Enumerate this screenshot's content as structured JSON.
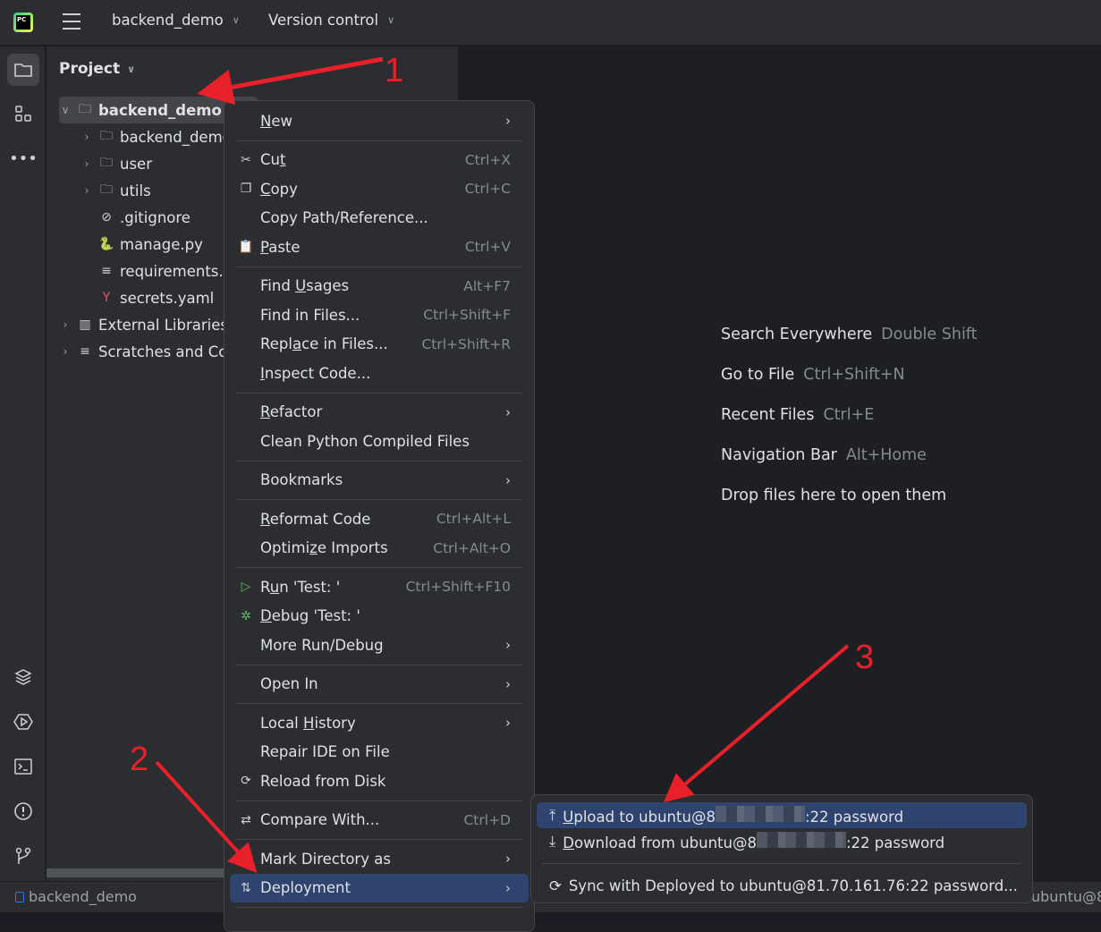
{
  "titlebar": {
    "project": "backend_demo",
    "vcs": "Version control"
  },
  "project_panel": {
    "title": "Project",
    "tree": [
      {
        "label": "backend_demo",
        "icon": "folder-icon",
        "expanded": true,
        "selected": true,
        "bold": true,
        "level": 0
      },
      {
        "label": "backend_demo",
        "icon": "package-folder-icon",
        "level": 1,
        "collapsible": true
      },
      {
        "label": "user",
        "icon": "package-folder-icon",
        "level": 1,
        "collapsible": true
      },
      {
        "label": "utils",
        "icon": "package-folder-icon",
        "level": 1,
        "collapsible": true
      },
      {
        "label": ".gitignore",
        "icon": "ignore-file-icon",
        "level": 1
      },
      {
        "label": "manage.py",
        "icon": "python-file-icon",
        "level": 1
      },
      {
        "label": "requirements.txt",
        "icon": "text-file-icon",
        "level": 1
      },
      {
        "label": "secrets.yaml",
        "icon": "yaml-file-icon",
        "level": 1
      },
      {
        "label": "External Libraries",
        "icon": "library-icon",
        "level": 0,
        "collapsible": true
      },
      {
        "label": "Scratches and Consoles",
        "icon": "scratches-icon",
        "level": 0,
        "collapsible": true
      }
    ]
  },
  "context_menu": [
    {
      "label": "New",
      "mn": 0,
      "sub": true
    },
    {
      "sep": true
    },
    {
      "label": "Cut",
      "mn": 2,
      "sc": "Ctrl+X",
      "icon": "scissors-icon"
    },
    {
      "label": "Copy",
      "mn": 0,
      "sc": "Ctrl+C",
      "icon": "copy-icon"
    },
    {
      "label": "Copy Path/Reference..."
    },
    {
      "label": "Paste",
      "mn": 0,
      "sc": "Ctrl+V",
      "icon": "paste-icon"
    },
    {
      "sep": true
    },
    {
      "label": "Find Usages",
      "mn": 5,
      "sc": "Alt+F7"
    },
    {
      "label": "Find in Files...",
      "sc": "Ctrl+Shift+F"
    },
    {
      "label": "Replace in Files...",
      "mn": 4,
      "sc": "Ctrl+Shift+R"
    },
    {
      "label": "Inspect Code...",
      "mn": 0
    },
    {
      "sep": true
    },
    {
      "label": "Refactor",
      "mn": 0,
      "sub": true
    },
    {
      "label": "Clean Python Compiled Files"
    },
    {
      "sep": true
    },
    {
      "label": "Bookmarks",
      "sub": true
    },
    {
      "sep": true
    },
    {
      "label": "Reformat Code",
      "mn": 0,
      "sc": "Ctrl+Alt+L"
    },
    {
      "label": "Optimize Imports",
      "mn": 6,
      "sc": "Ctrl+Alt+O"
    },
    {
      "sep": true
    },
    {
      "label": "Run 'Test: '",
      "mn": 1,
      "sc": "Ctrl+Shift+F10",
      "icon": "run-icon"
    },
    {
      "label": "Debug 'Test: '",
      "mn": 0,
      "icon": "debug-icon"
    },
    {
      "label": "More Run/Debug",
      "sub": true
    },
    {
      "sep": true
    },
    {
      "label": "Open In",
      "sub": true
    },
    {
      "sep": true
    },
    {
      "label": "Local History",
      "mn": 6,
      "sub": true
    },
    {
      "label": "Repair IDE on File"
    },
    {
      "label": "Reload from Disk",
      "icon": "reload-icon"
    },
    {
      "sep": true
    },
    {
      "label": "Compare With...",
      "sc": "Ctrl+D",
      "icon": "compare-icon"
    },
    {
      "sep": true
    },
    {
      "label": "Mark Directory as",
      "sub": true
    },
    {
      "label": "Deployment",
      "sub": true,
      "icon": "deployment-icon",
      "highlighted": true
    },
    {
      "sep": true
    }
  ],
  "submenu": {
    "upload": {
      "prefix": "Upload to ubuntu@8",
      "suffix": ":22 password"
    },
    "download": {
      "prefix": "Download from ubuntu@8",
      "suffix": ":22 password"
    },
    "sync": {
      "label": "Sync with Deployed to ubuntu@81.70.161.76:22 password..."
    }
  },
  "editor_hints": [
    {
      "label": "Search Everywhere",
      "key": "Double Shift"
    },
    {
      "label": "Go to File",
      "key": "Ctrl+Shift+N"
    },
    {
      "label": "Recent Files",
      "key": "Ctrl+E"
    },
    {
      "label": "Navigation Bar",
      "key": "Alt+Home"
    },
    {
      "label": "Drop files here to open them",
      "key": ""
    }
  ],
  "statusbar": {
    "breadcrumb": "backend_demo",
    "right": "ubuntu@8"
  },
  "annotations": {
    "a1": "1",
    "a2": "2",
    "a3": "3",
    "color": "#e8202a"
  },
  "colors": {
    "highlight": "#2e436e",
    "panel": "#2b2d30",
    "editor": "#1e1f22"
  }
}
